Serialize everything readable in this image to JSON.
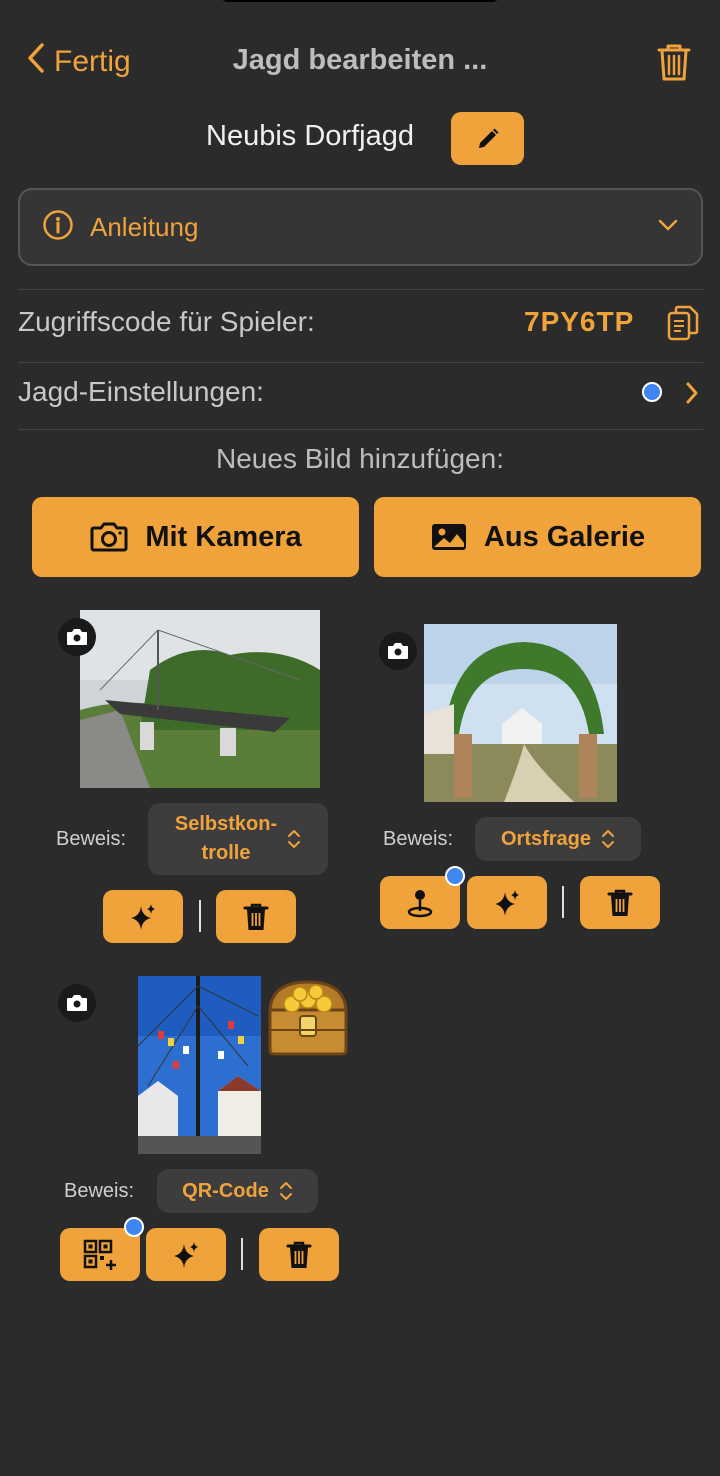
{
  "nav": {
    "back_label": "Fertig",
    "title": "Jagd bearbeiten ..."
  },
  "hunt": {
    "name": "Neubis Dorfjagd"
  },
  "guide": {
    "label": "Anleitung"
  },
  "access": {
    "label": "Zugriffscode für Spieler:",
    "code": "7PY6TP"
  },
  "settings": {
    "label": "Jagd-Einstellungen:"
  },
  "add_image": {
    "title": "Neues Bild hinzufügen:",
    "camera_label": "Mit Kamera",
    "gallery_label": "Aus Galerie"
  },
  "images": [
    {
      "proof_label": "Beweis:",
      "proof_value_line1": "Selbstkon-",
      "proof_value_line2": "trolle"
    },
    {
      "proof_label": "Beweis:",
      "proof_value": "Ortsfrage"
    },
    {
      "proof_label": "Beweis:",
      "proof_value": "QR-Code"
    }
  ],
  "colors": {
    "accent": "#f0a23b",
    "background": "#2b2b2b",
    "dot": "#3e86f2"
  }
}
